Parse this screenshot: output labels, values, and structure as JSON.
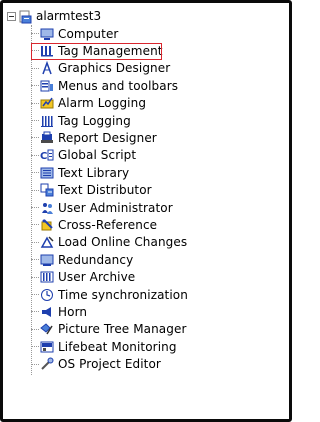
{
  "project": {
    "name": "alarmtest3"
  },
  "items": [
    {
      "label": "Computer",
      "icon": "computer-icon"
    },
    {
      "label": "Tag Management",
      "icon": "tag-management-icon"
    },
    {
      "label": "Graphics Designer",
      "icon": "graphics-designer-icon"
    },
    {
      "label": "Menus and toolbars",
      "icon": "menus-toolbars-icon"
    },
    {
      "label": "Alarm Logging",
      "icon": "alarm-logging-icon"
    },
    {
      "label": "Tag Logging",
      "icon": "tag-logging-icon"
    },
    {
      "label": "Report Designer",
      "icon": "report-designer-icon"
    },
    {
      "label": "Global Script",
      "icon": "global-script-icon"
    },
    {
      "label": "Text Library",
      "icon": "text-library-icon"
    },
    {
      "label": "Text Distributor",
      "icon": "text-distributor-icon"
    },
    {
      "label": "User Administrator",
      "icon": "user-administrator-icon"
    },
    {
      "label": "Cross-Reference",
      "icon": "cross-reference-icon"
    },
    {
      "label": "Load Online Changes",
      "icon": "load-online-changes-icon"
    },
    {
      "label": "Redundancy",
      "icon": "redundancy-icon"
    },
    {
      "label": "User Archive",
      "icon": "user-archive-icon"
    },
    {
      "label": "Time synchronization",
      "icon": "time-sync-icon"
    },
    {
      "label": "Horn",
      "icon": "horn-icon"
    },
    {
      "label": "Picture Tree Manager",
      "icon": "picture-tree-manager-icon"
    },
    {
      "label": "Lifebeat Monitoring",
      "icon": "lifebeat-monitoring-icon"
    },
    {
      "label": "OS Project Editor",
      "icon": "os-project-editor-icon"
    }
  ],
  "highlighted_item": "Tag Management",
  "colors": {
    "highlight": "#d9262e",
    "tree_line": "#9a9a9a",
    "icon_blue": "#1e3fae"
  }
}
